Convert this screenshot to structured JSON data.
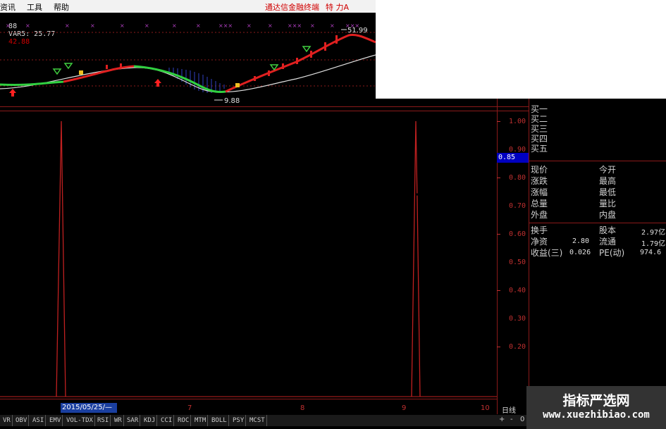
{
  "menu": {
    "items": [
      "资讯",
      "工具",
      "帮助"
    ],
    "brand": "通达信金融终端",
    "brand2": "特 力A"
  },
  "indicator": {
    "prefix": "88",
    "var5_label": "VAR5: 25.77",
    "value2": "42.88"
  },
  "price_chart": {
    "high_label": "51.99",
    "low_label": "9.88"
  },
  "y_axis": {
    "labels": [
      "1.00",
      "0.90",
      "0.80",
      "0.70",
      "0.60",
      "0.50",
      "0.40",
      "0.30",
      "0.20"
    ],
    "current": "0.85"
  },
  "order_book": [
    "买一",
    "买二",
    "买三",
    "买四",
    "买五"
  ],
  "quote_rows": [
    {
      "l": "现价",
      "r": "今开"
    },
    {
      "l": "涨跌",
      "r": "最高"
    },
    {
      "l": "涨幅",
      "r": "最低"
    },
    {
      "l": "总量",
      "r": "量比"
    },
    {
      "l": "外盘",
      "r": "内盘"
    }
  ],
  "stats": [
    {
      "l": "换手",
      "v": "",
      "r": "股本",
      "rv": "2.97亿"
    },
    {
      "l": "净资",
      "v": "2.80",
      "r": "流通",
      "rv": "1.79亿"
    },
    {
      "l": "收益(三)",
      "v": "0.026",
      "r": "PE(动)",
      "rv": "974.6"
    }
  ],
  "x_axis": {
    "date": "2015/05/25/—",
    "labels": [
      "7",
      "8",
      "9",
      "10"
    ],
    "period": "日线"
  },
  "tabs": [
    "VR",
    "OBV",
    "ASI",
    "EMV",
    "VOL-TDX",
    "RSI",
    "WR",
    "SAR",
    "KDJ",
    "CCI",
    "ROC",
    "MTM",
    "BOLL",
    "PSY",
    "MCST"
  ],
  "controls": [
    "+",
    "-",
    "0"
  ],
  "watermark": {
    "title": "指标严选网",
    "url": "www.xuezhibiao.com"
  },
  "colors": {
    "accent": "#d00000",
    "axis": "#8b1a1a",
    "up": "#ff2020",
    "down": "#20c040"
  }
}
